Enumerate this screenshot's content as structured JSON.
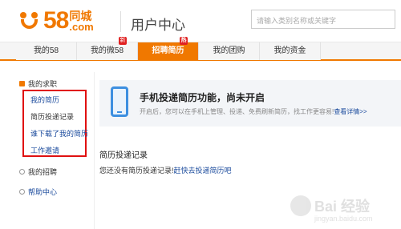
{
  "header": {
    "logo_num": "58",
    "logo_cn": "同城",
    "logo_com": ".com",
    "title": "用户中心",
    "search_placeholder": "请输入类别名称或关键字"
  },
  "nav": {
    "items": [
      {
        "label": "我的58"
      },
      {
        "label": "我的微58",
        "badge": "新"
      },
      {
        "label": "招聘简历",
        "badge": "热"
      },
      {
        "label": "我的团购"
      },
      {
        "label": "我的资金"
      }
    ]
  },
  "sidebar": {
    "group_job": "我的求职",
    "items": [
      {
        "label": "我的简历"
      },
      {
        "label": "简历投递记录"
      },
      {
        "label": "谁下载了我的简历"
      },
      {
        "label": "工作邀请"
      }
    ],
    "group_recruit": "我的招聘",
    "help": "帮助中心"
  },
  "promo": {
    "title": "手机投递简历功能，尚未开启",
    "desc": "开启后，您可以在手机上管理、投递、免费刷新简历，找工作更容易!",
    "link": "查看详情>>"
  },
  "records": {
    "title": "简历投递记录",
    "empty": "您还没有简历投递记录!",
    "link": "赶快去投递简历吧"
  },
  "watermark": {
    "text": "Bai 经验",
    "url": "jingyan.baidu.com"
  },
  "colors": {
    "brand": "#f07800",
    "link": "#1a4a9c",
    "highlight": "#e01010"
  }
}
